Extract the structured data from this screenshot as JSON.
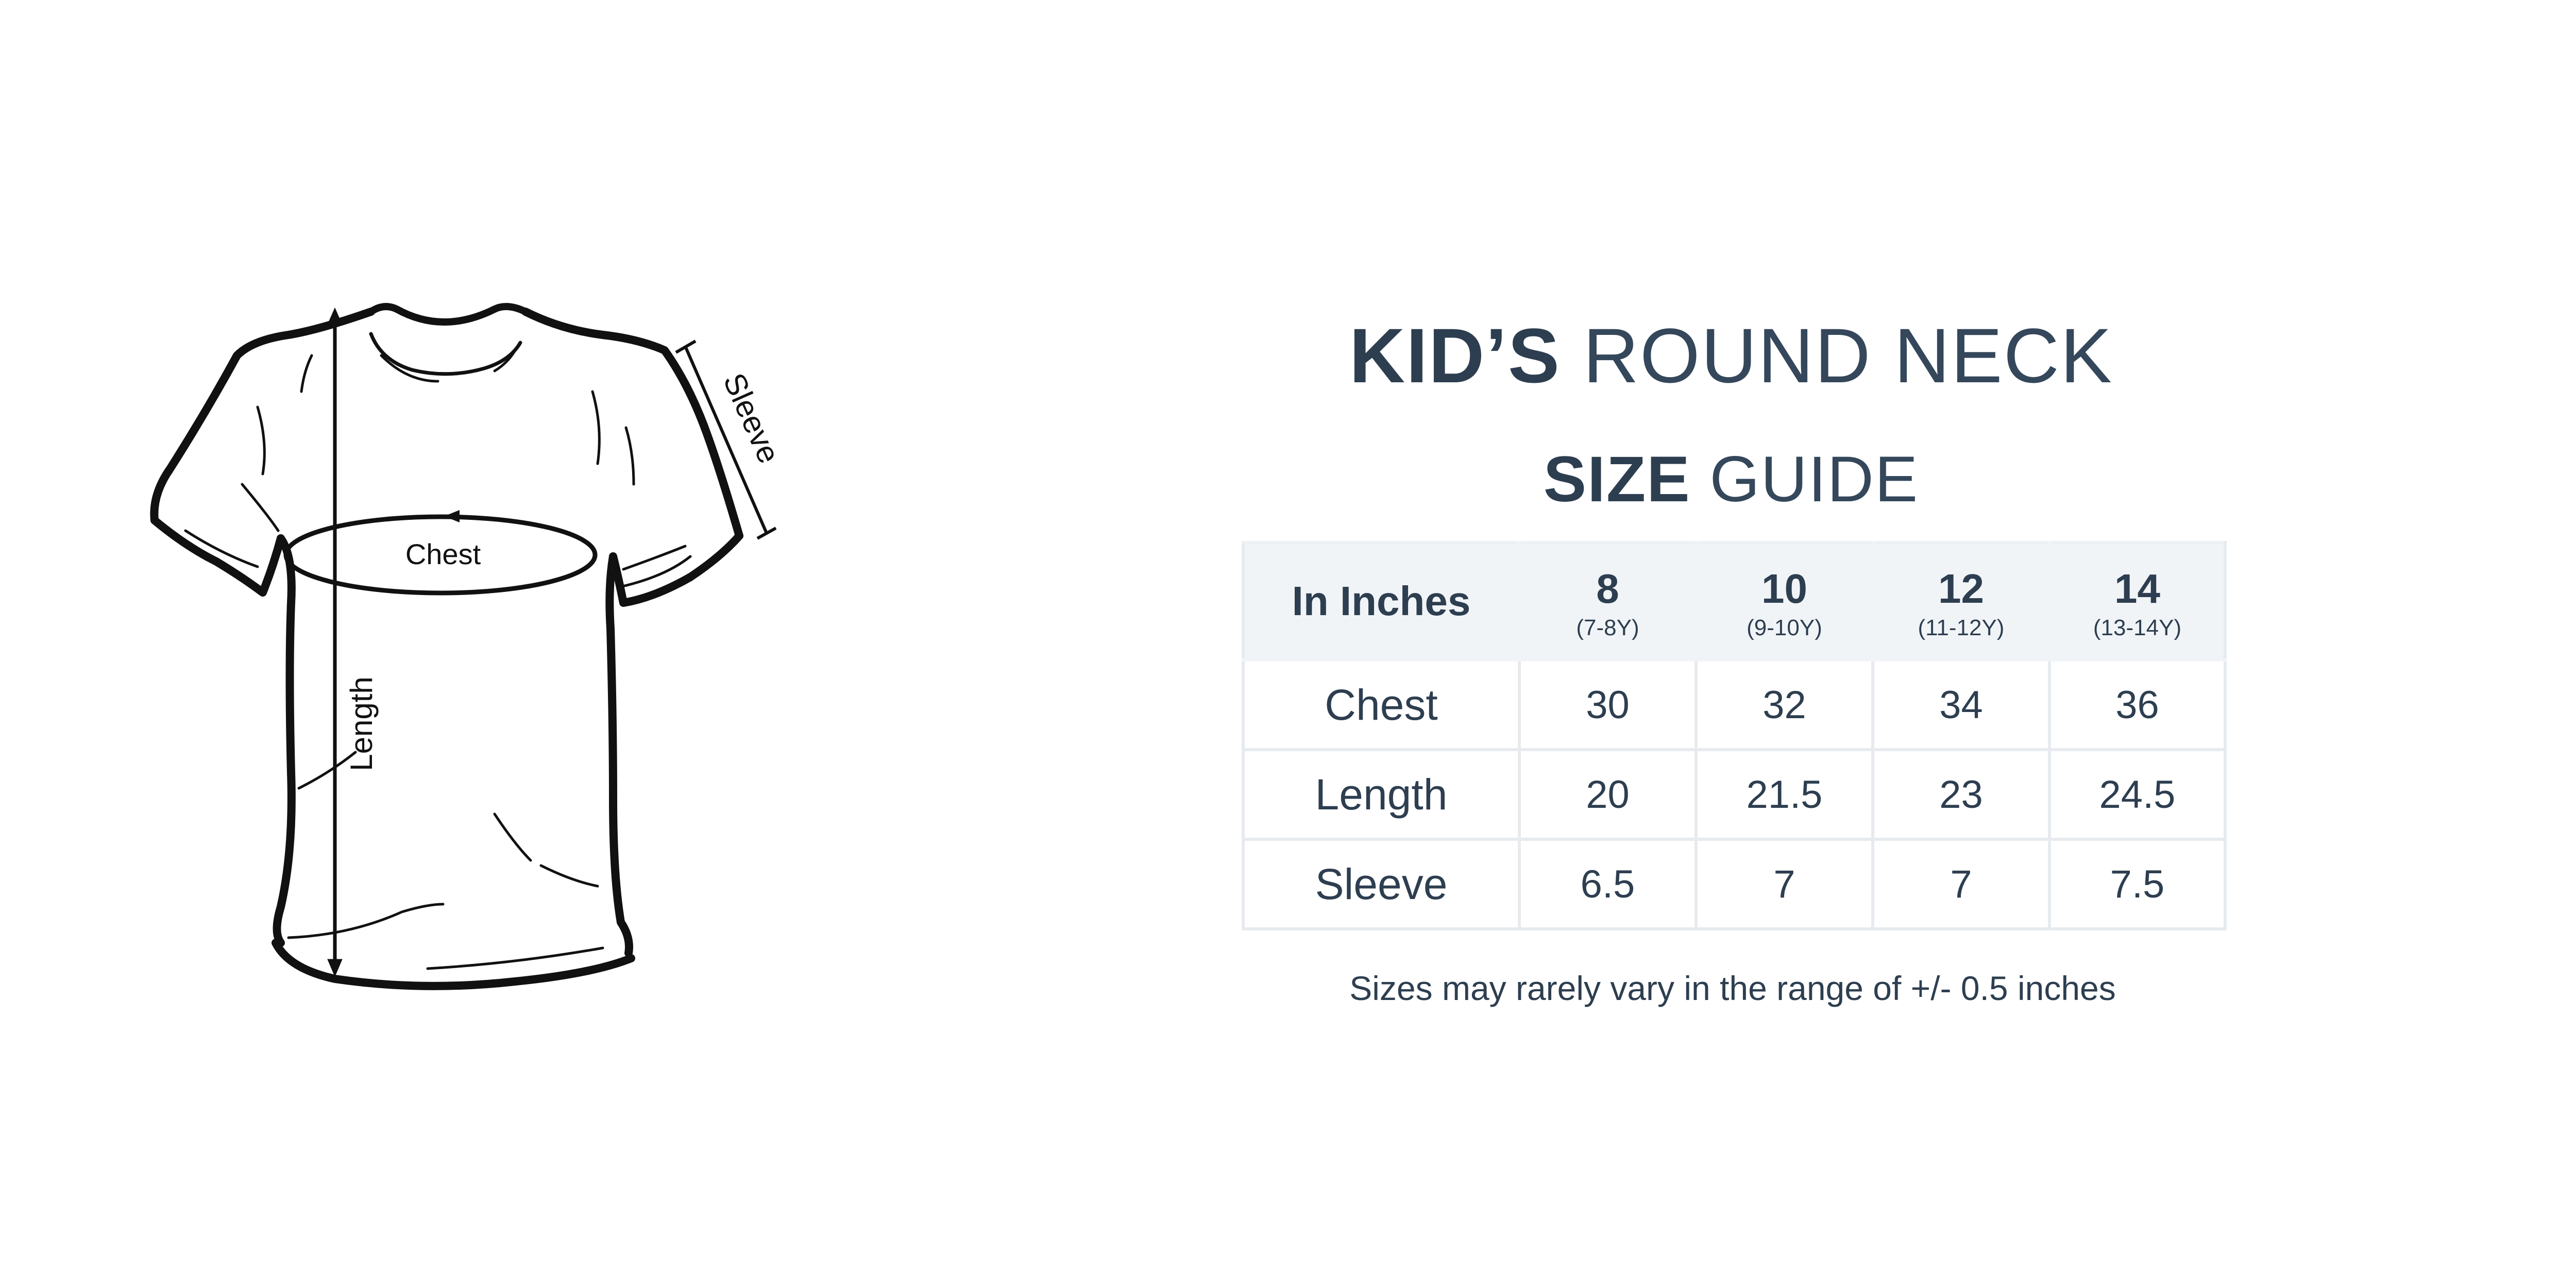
{
  "diagram": {
    "labels": {
      "chest": "Chest",
      "length": "Length",
      "sleeve": "Sleeve"
    },
    "icon": "t-shirt-outline"
  },
  "title": {
    "line1_bold": "KID’S",
    "line1_light": "ROUND NECK",
    "line2_bold": "SIZE",
    "line2_light": "GUIDE"
  },
  "table": {
    "unit_header": "In Inches",
    "sizes": [
      {
        "size": "8",
        "age": "(7-8Y)"
      },
      {
        "size": "10",
        "age": "(9-10Y)"
      },
      {
        "size": "12",
        "age": "(11-12Y)"
      },
      {
        "size": "14",
        "age": "(13-14Y)"
      }
    ],
    "rows": [
      {
        "label": "Chest",
        "values": [
          "30",
          "32",
          "34",
          "36"
        ]
      },
      {
        "label": "Length",
        "values": [
          "20",
          "21.5",
          "23",
          "24.5"
        ]
      },
      {
        "label": "Sleeve",
        "values": [
          "6.5",
          "7",
          "7",
          "7.5"
        ]
      }
    ]
  },
  "note": "Sizes may rarely vary in the range of +/- 0.5 inches",
  "colors": {
    "text": "#2d3e50",
    "header_bg": "#f1f4f7",
    "grid": "#e7ebef"
  }
}
